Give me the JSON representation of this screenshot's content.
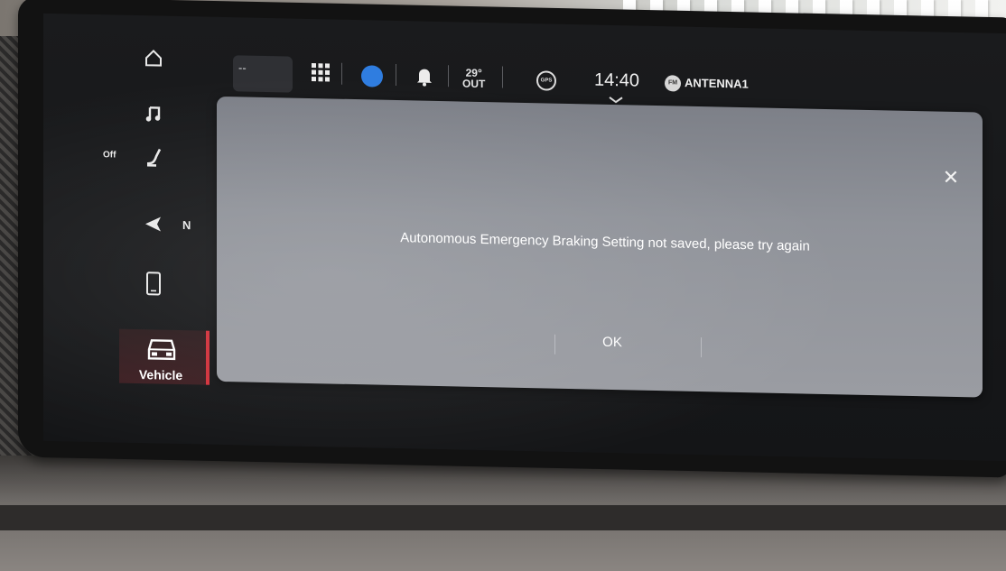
{
  "sidebar": {
    "items": [
      {
        "icon": "home-icon"
      },
      {
        "icon": "music-note-icon"
      },
      {
        "icon": "seat-heat-icon",
        "label": "Off"
      },
      {
        "icon": "navigation-arrow-icon",
        "label": "N"
      },
      {
        "icon": "phone-icon"
      }
    ],
    "vehicle": {
      "icon": "car-icon",
      "label": "Vehicle"
    },
    "accent": "#d3303a"
  },
  "statusbar": {
    "left_pill_value": "--",
    "right_pill_value": "--",
    "temperature": "29°",
    "temperature_label": "OUT",
    "gps_label": "GPS",
    "clock": "14:40",
    "fm_badge": "FM",
    "station": "ANTENNA1",
    "icons": [
      "apps-grid-icon",
      "user-profile-icon",
      "notification-bell-icon",
      "alexa-icon"
    ]
  },
  "dialog": {
    "message": "Autonomous Emergency Braking Setting not saved, please try again",
    "ok_label": "OK",
    "close_icon": "close-icon"
  }
}
